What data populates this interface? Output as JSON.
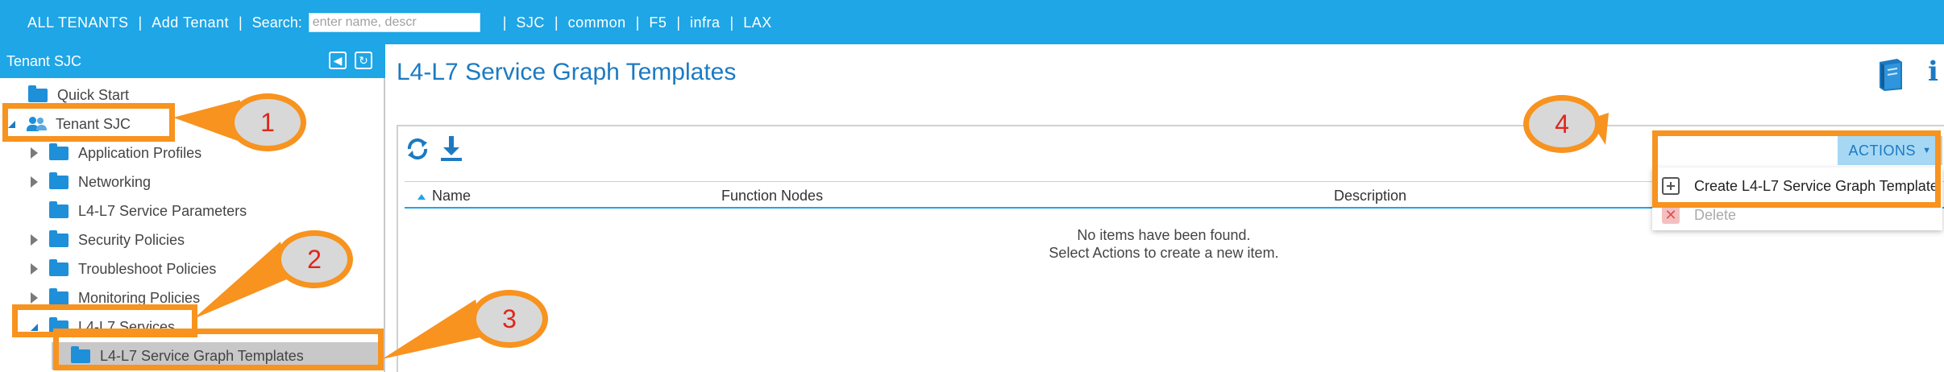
{
  "topbar": {
    "links": [
      "ALL TENANTS",
      "Add Tenant"
    ],
    "search_label": "Search:",
    "search_placeholder": "enter name, descr",
    "quick_tenants": [
      "SJC",
      "common",
      "F5",
      "infra",
      "LAX"
    ],
    "separator": "|"
  },
  "sidebar": {
    "title": "Tenant SJC",
    "items": [
      {
        "label": "Quick Start"
      },
      {
        "label": "Tenant SJC"
      },
      {
        "label": "Application Profiles"
      },
      {
        "label": "Networking"
      },
      {
        "label": "L4-L7 Service Parameters"
      },
      {
        "label": "Security Policies"
      },
      {
        "label": "Troubleshoot Policies"
      },
      {
        "label": "Monitoring Policies"
      },
      {
        "label": "L4-L7 Services"
      },
      {
        "label": "L4-L7 Service Graph Templates"
      }
    ]
  },
  "main": {
    "title": "L4-L7 Service Graph Templates",
    "actions_label": "ACTIONS",
    "columns": [
      "Name",
      "Function Nodes",
      "Description"
    ],
    "empty_line1": "No items have been found.",
    "empty_line2": "Select Actions to create a new item."
  },
  "menu": {
    "create_label": "Create L4-L7 Service Graph Template",
    "delete_label": "Delete"
  },
  "annotations": {
    "labels": [
      "1",
      "2",
      "3",
      "4"
    ],
    "color": "#f7931e",
    "text_color": "#e0261c"
  },
  "colors": {
    "header_blue": "#1ea6e6",
    "title_blue": "#1c7ac2",
    "folder_blue": "#1e8fd9"
  }
}
